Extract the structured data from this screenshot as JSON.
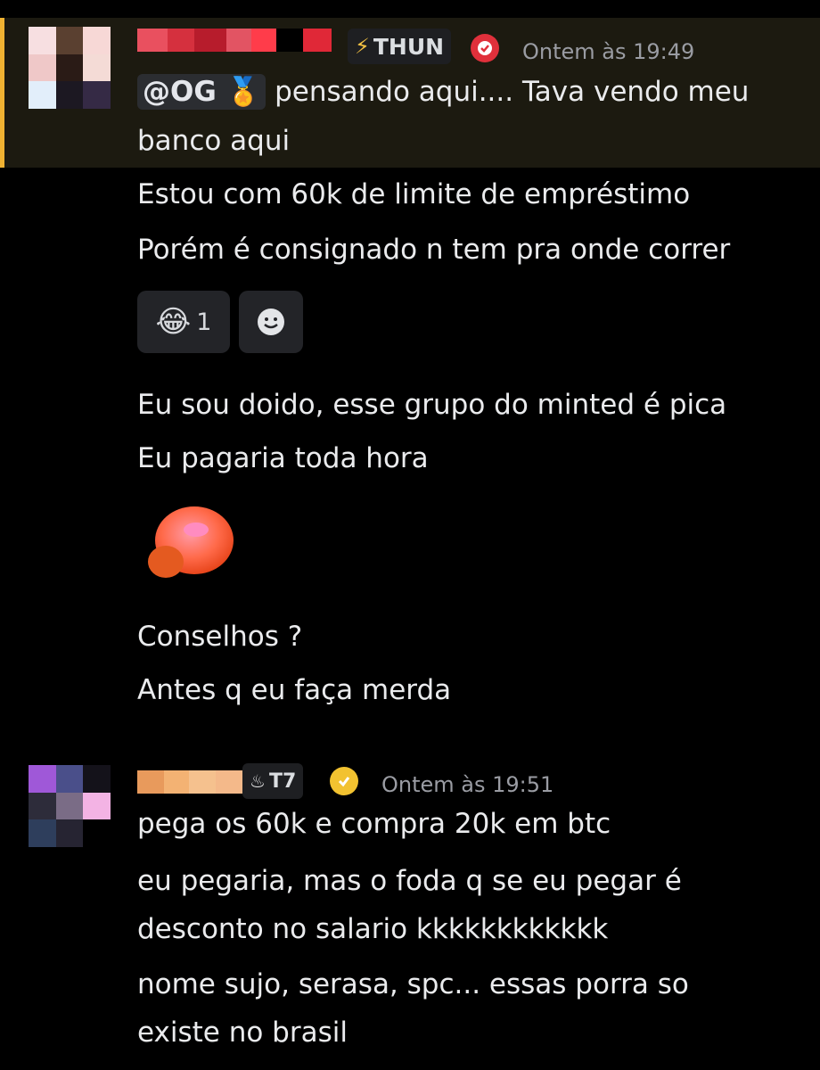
{
  "messages": [
    {
      "tag": "THUN",
      "timestamp": "Ontem às 19:49",
      "mention": "@OG",
      "mention_emoji": "🏅",
      "lines": [
        "pensando aqui.... Tava vendo meu",
        "banco aqui",
        "Estou com 60k de limite de empréstimo",
        "Porém é consignado n tem pra onde correr"
      ],
      "reactions": [
        {
          "emoji": "😂",
          "count": "1"
        },
        {
          "emoji": "add-reaction-icon",
          "count": ""
        }
      ],
      "lines2": [
        "Eu sou doido, esse grupo do minted é pica",
        "Eu pagaria toda hora"
      ],
      "sticker": "blushing-blob-emoji",
      "lines3": [
        "Conselhos ?",
        "Antes q eu faça merda"
      ]
    },
    {
      "tag": "T7",
      "timestamp": "Ontem às 19:51",
      "lines": [
        "pega os 60k e compra 20k em btc",
        "eu pegaria, mas o foda q se eu pegar é",
        "desconto no salario kkkkkkkkkkkk",
        "nome sujo, serasa, spc... essas porra so",
        "existe no brasil"
      ]
    }
  ],
  "colors": {
    "background": "#000000",
    "highlight": "#1c1a10",
    "highlight_bar": "#f0b232",
    "badge_red": "#e0303b",
    "badge_gold": "#f2c230"
  }
}
